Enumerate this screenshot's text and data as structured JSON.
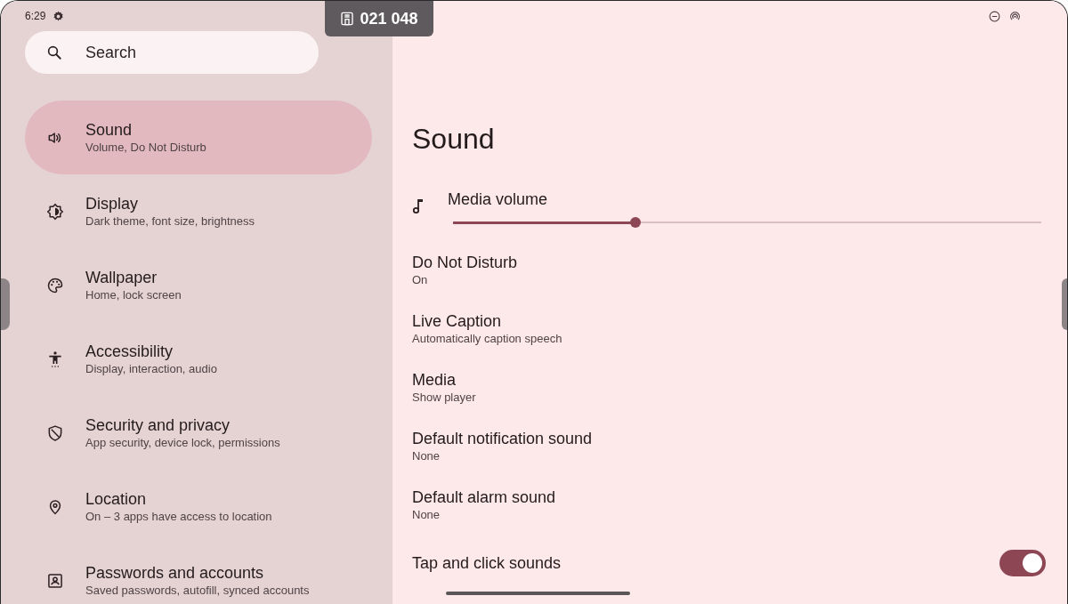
{
  "status_bar": {
    "time": "6:29"
  },
  "overlay_badge": {
    "text": "021 048"
  },
  "search": {
    "placeholder": "Search"
  },
  "sidebar": {
    "items": [
      {
        "title": "Sound",
        "summary": "Volume, Do Not Disturb",
        "selected": true
      },
      {
        "title": "Display",
        "summary": "Dark theme, font size, brightness",
        "selected": false
      },
      {
        "title": "Wallpaper",
        "summary": "Home, lock screen",
        "selected": false
      },
      {
        "title": "Accessibility",
        "summary": "Display, interaction, audio",
        "selected": false
      },
      {
        "title": "Security and privacy",
        "summary": "App security, device lock, permissions",
        "selected": false
      },
      {
        "title": "Location",
        "summary": "On – 3 apps have access to location",
        "selected": false
      },
      {
        "title": "Passwords and accounts",
        "summary": "Saved passwords, autofill, synced accounts",
        "selected": false
      }
    ]
  },
  "detail": {
    "title": "Sound",
    "media_volume": {
      "label": "Media volume",
      "level": 0.31
    },
    "rows": [
      {
        "kind": "text",
        "title": "Do Not Disturb",
        "summary": "On"
      },
      {
        "kind": "text",
        "title": "Live Caption",
        "summary": "Automatically caption speech"
      },
      {
        "kind": "text",
        "title": "Media",
        "summary": "Show player"
      },
      {
        "kind": "text",
        "title": "Default notification sound",
        "summary": "None"
      },
      {
        "kind": "text",
        "title": "Default alarm sound",
        "summary": "None"
      },
      {
        "kind": "switch",
        "title": "Tap and click sounds",
        "on": true
      }
    ]
  }
}
